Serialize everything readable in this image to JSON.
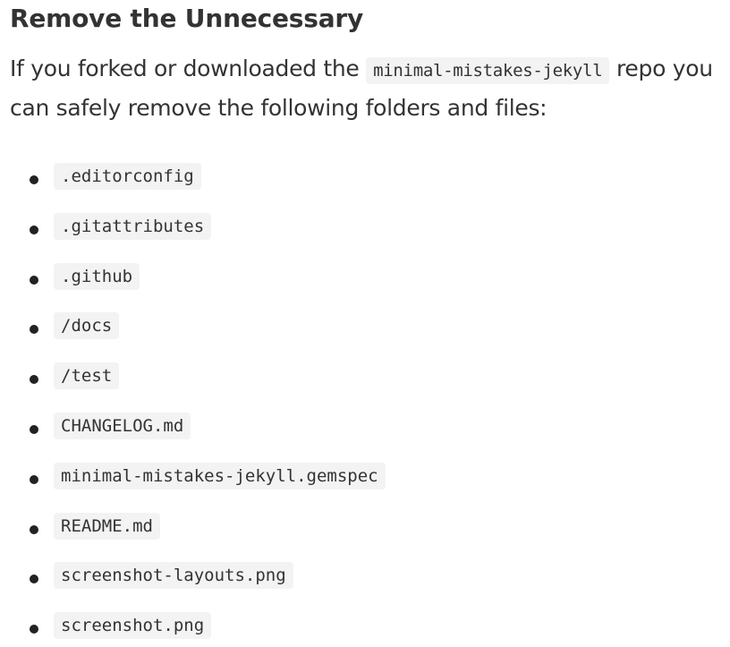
{
  "section": {
    "title": "Remove the Unnecessary"
  },
  "intro": {
    "text_before": "If you forked or downloaded the ",
    "repo_name": "minimal-mistakes-jekyll",
    "text_after": " repo you can safely remove the following folders and files:"
  },
  "files": [
    ".editorconfig",
    ".gitattributes",
    ".github",
    "/docs",
    "/test",
    "CHANGELOG.md",
    "minimal-mistakes-jekyll.gemspec",
    "README.md",
    "screenshot-layouts.png",
    "screenshot.png"
  ]
}
